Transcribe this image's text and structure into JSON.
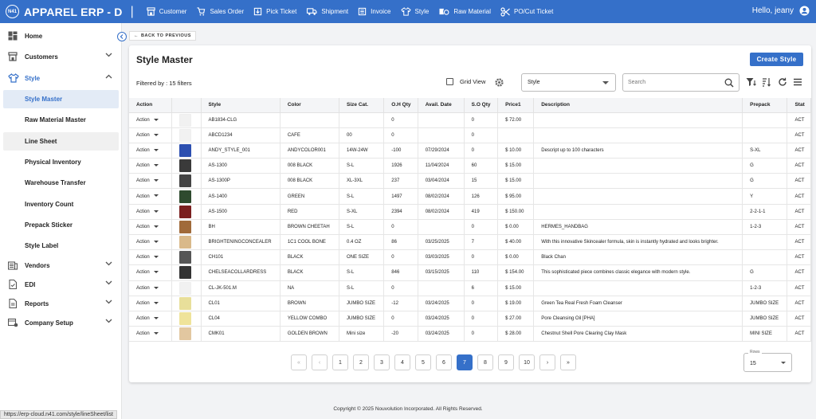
{
  "app": {
    "logo_text": "N41",
    "title": "APPAREL ERP  -  D",
    "greeting": "Hello, jeany"
  },
  "topnav": [
    {
      "label": "Customer",
      "icon": "store-icon"
    },
    {
      "label": "Sales Order",
      "icon": "cart-icon"
    },
    {
      "label": "Pick Ticket",
      "icon": "pick-ticket-icon"
    },
    {
      "label": "Shipment",
      "icon": "truck-icon"
    },
    {
      "label": "Invoice",
      "icon": "invoice-icon"
    },
    {
      "label": "Style",
      "icon": "shirt-icon"
    },
    {
      "label": "Raw Material",
      "icon": "fabric-icon"
    },
    {
      "label": "PO/Cut Ticket",
      "icon": "scissors-icon"
    }
  ],
  "sidebar": {
    "items": [
      {
        "label": "Home",
        "icon": "dashboard-icon"
      },
      {
        "label": "Customers",
        "icon": "store-icon"
      },
      {
        "label": "Style",
        "icon": "shirt-icon"
      },
      {
        "label": "Vendors",
        "icon": "vendors-icon"
      },
      {
        "label": "EDI",
        "icon": "edi-icon"
      },
      {
        "label": "Reports",
        "icon": "reports-icon"
      },
      {
        "label": "Company Setup",
        "icon": "company-setup-icon"
      }
    ],
    "style_sub": [
      "Style Master",
      "Raw Material Master",
      "Line Sheet",
      "Physical Inventory",
      "Warehouse Transfer",
      "Inventory Count",
      "Prepack Sticker",
      "Style Label"
    ]
  },
  "back_button": "BACK TO PREVIOUS",
  "page": {
    "title": "Style Master",
    "create_label": "Create Style",
    "filter_text": "Filtered by :  15 filters",
    "grid_view_label": "Grid View",
    "select_value": "Style",
    "search_placeholder": "Search"
  },
  "table": {
    "columns": [
      "Action",
      "",
      "Style",
      "Color",
      "Size Cat.",
      "O.H Qty",
      "Avail. Date",
      "S.O Qty",
      "Price1",
      "Description",
      "Prepack",
      "Stat"
    ],
    "rows": [
      {
        "action": "Action",
        "thumb": "",
        "style": "AB1834-CLG",
        "color": "",
        "size": "",
        "oh": "0",
        "date": "",
        "so": "0",
        "price": "$ 72.00",
        "desc": "",
        "prepack": "",
        "stat": "ACT"
      },
      {
        "action": "Action",
        "thumb": "",
        "style": "ABCD1234",
        "color": "CAFE",
        "size": "00",
        "oh": "0",
        "date": "",
        "so": "0",
        "price": "",
        "desc": "",
        "prepack": "",
        "stat": "ACT"
      },
      {
        "action": "Action",
        "thumb": "#2c4fb0",
        "style": "ANDY_STYLE_001",
        "color": "ANDYCOLOR001",
        "size": "14W-24W",
        "oh": "-100",
        "date": "07/29/2024",
        "so": "0",
        "price": "$ 10.00",
        "desc": "Descript up to 100 characters",
        "prepack": "S-XL",
        "stat": "ACT"
      },
      {
        "action": "Action",
        "thumb": "#3a3a3a",
        "style": "AS-1300",
        "color": "008 BLACK",
        "size": "S-L",
        "oh": "1926",
        "date": "11/04/2024",
        "so": "60",
        "price": "$ 15.00",
        "desc": "",
        "prepack": "G",
        "stat": "ACT"
      },
      {
        "action": "Action",
        "thumb": "#444444",
        "style": "AS-1300P",
        "color": "008 BLACK",
        "size": "XL-3XL",
        "oh": "237",
        "date": "03/04/2024",
        "so": "15",
        "price": "$ 15.00",
        "desc": "",
        "prepack": "G",
        "stat": "ACT"
      },
      {
        "action": "Action",
        "thumb": "#2e4a2e",
        "style": "AS-1400",
        "color": "GREEN",
        "size": "S-L",
        "oh": "1497",
        "date": "08/02/2024",
        "so": "126",
        "price": "$ 95.00",
        "desc": "",
        "prepack": "Y",
        "stat": "ACT"
      },
      {
        "action": "Action",
        "thumb": "#7a1f1f",
        "style": "AS-1500",
        "color": "RED",
        "size": "S-XL",
        "oh": "2394",
        "date": "08/02/2024",
        "so": "419",
        "price": "$ 150.00",
        "desc": "",
        "prepack": "2-2-1-1",
        "stat": "ACT"
      },
      {
        "action": "Action",
        "thumb": "#a06a3a",
        "style": "BH",
        "color": "BROWN CHEETAH",
        "size": "S-L",
        "oh": "0",
        "date": "",
        "so": "0",
        "price": "$ 0.00",
        "desc": "HERMES_HANDBAG",
        "prepack": "1-2-3",
        "stat": "ACT"
      },
      {
        "action": "Action",
        "thumb": "#d9b98a",
        "style": "BRIGHTENINGCONCEALER",
        "color": "1C1 COOL BONE",
        "size": "0.4 OZ",
        "oh": "86",
        "date": "03/25/2025",
        "so": "7",
        "price": "$ 40.00",
        "desc": "With this innovative Skincealer formula, skin is instantly hydrated and looks brighter.",
        "prepack": "",
        "stat": "ACT"
      },
      {
        "action": "Action",
        "thumb": "#555555",
        "style": "CH101",
        "color": "BLACK",
        "size": "ONE SIZE",
        "oh": "0",
        "date": "03/03/2025",
        "so": "0",
        "price": "$ 0.00",
        "desc": "Black Chan",
        "prepack": "",
        "stat": "ACT"
      },
      {
        "action": "Action",
        "thumb": "#333333",
        "style": "CHELSEACOLLARDRESS",
        "color": "BLACK",
        "size": "S-L",
        "oh": "846",
        "date": "03/15/2025",
        "so": "110",
        "price": "$ 154.00",
        "desc": "This sophisticated piece combines classic elegance with modern style.",
        "prepack": "G",
        "stat": "ACT"
      },
      {
        "action": "Action",
        "thumb": "",
        "style": "CL-JK-501.M",
        "color": "NA",
        "size": "S-L",
        "oh": "0",
        "date": "",
        "so": "6",
        "price": "$ 15.00",
        "desc": "",
        "prepack": "1-2-3",
        "stat": "ACT"
      },
      {
        "action": "Action",
        "thumb": "#e8df9a",
        "style": "CL01",
        "color": "BROWN",
        "size": "JUMBO SIZE",
        "oh": "-12",
        "date": "03/24/2025",
        "so": "0",
        "price": "$ 19.00",
        "desc": "Green Tea Real Fresh Foam Cleanser",
        "prepack": "JUMBO SIZE",
        "stat": "ACT"
      },
      {
        "action": "Action",
        "thumb": "#efe39a",
        "style": "CL04",
        "color": "YELLOW COMBO",
        "size": "JUMBO SIZE",
        "oh": "0",
        "date": "03/24/2025",
        "so": "0",
        "price": "$ 27.00",
        "desc": "Pore Cleansing Oil [PHA]",
        "prepack": "JUMBO SIZE",
        "stat": "ACT"
      },
      {
        "action": "Action",
        "thumb": "#e2c7a0",
        "style": "CMK01",
        "color": "GOLDEN BROWN",
        "size": "Mini size",
        "oh": "-20",
        "date": "03/24/2025",
        "so": "0",
        "price": "$ 28.00",
        "desc": "Chestnut Shell Pore Clearing Clay Mask",
        "prepack": "MINI SIZE",
        "stat": "ACT"
      }
    ]
  },
  "pagination": {
    "pages": [
      "1",
      "2",
      "3",
      "4",
      "5",
      "6",
      "7",
      "8",
      "9",
      "10"
    ],
    "current": "7",
    "rows_label": "Rows",
    "rows_value": "15"
  },
  "footer": "Copyright © 2025 Nouvolution Incorporated. All Rights Reserved.",
  "status_url": "https://erp-cloud.n41.com/style/lineSheet/list",
  "colors": {
    "primary": "#3570c9",
    "selected_bg": "#e3ebf6"
  }
}
